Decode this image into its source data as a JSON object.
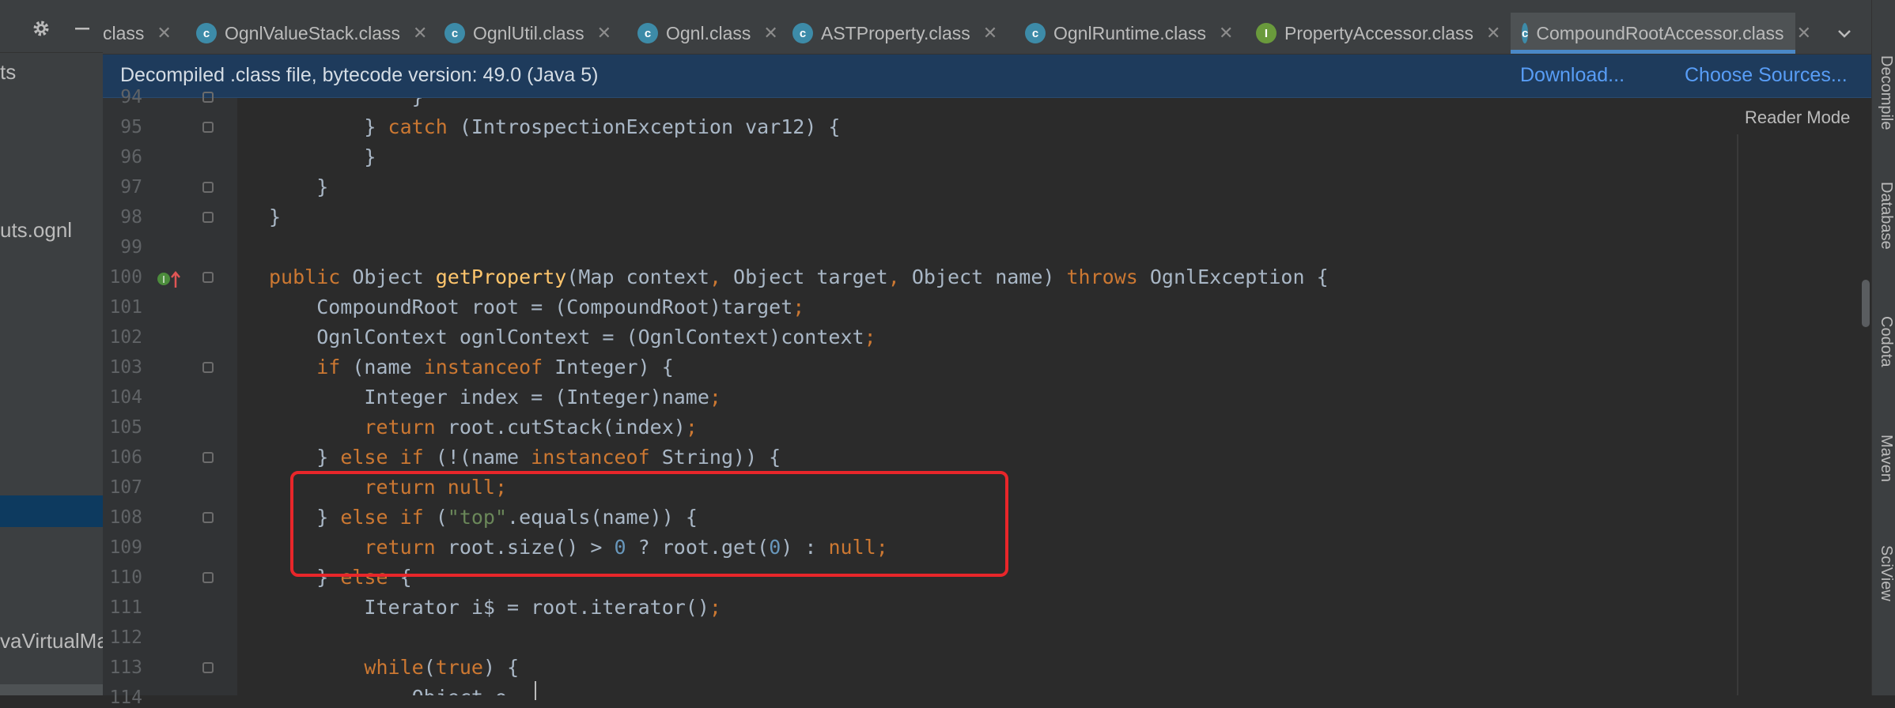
{
  "left_panel": {
    "items": [
      {
        "label": "ts"
      },
      {
        "label": "uts.ognl"
      },
      {
        "label": "vaVirtualMa"
      }
    ]
  },
  "tabs": [
    {
      "label": "class",
      "icon": "class-icon",
      "active": false
    },
    {
      "label": "OgnlValueStack.class",
      "icon": "class-icon",
      "active": false
    },
    {
      "label": "OgnlUtil.class",
      "icon": "class-icon",
      "active": false
    },
    {
      "label": "Ognl.class",
      "icon": "class-icon",
      "active": false
    },
    {
      "label": "ASTProperty.class",
      "icon": "class-icon",
      "active": false
    },
    {
      "label": "OgnlRuntime.class",
      "icon": "class-icon",
      "active": false
    },
    {
      "label": "PropertyAccessor.class",
      "icon": "interface-icon",
      "active": false
    },
    {
      "label": "CompoundRootAccessor.class",
      "icon": "class-icon",
      "active": true
    }
  ],
  "banner": {
    "text": "Decompiled .class file, bytecode version: 49.0 (Java 5)",
    "download_label": "Download...",
    "choose_sources_label": "Choose Sources..."
  },
  "reader_mode_label": "Reader Mode",
  "right_sidebar": {
    "items": [
      "Decompile",
      "Database",
      "Codota",
      "Maven",
      "SciView"
    ]
  },
  "code": {
    "lines": [
      {
        "n": "94",
        "text": "            }"
      },
      {
        "n": "95",
        "text": "        } catch (IntrospectionException var12) {"
      },
      {
        "n": "96",
        "text": "        }"
      },
      {
        "n": "97",
        "text": "    }"
      },
      {
        "n": "98",
        "text": "}"
      },
      {
        "n": "99",
        "text": ""
      },
      {
        "n": "100",
        "text": "public Object getProperty(Map context, Object target, Object name) throws OgnlException {"
      },
      {
        "n": "101",
        "text": "    CompoundRoot root = (CompoundRoot)target;"
      },
      {
        "n": "102",
        "text": "    OgnlContext ognlContext = (OgnlContext)context;"
      },
      {
        "n": "103",
        "text": "    if (name instanceof Integer) {"
      },
      {
        "n": "104",
        "text": "        Integer index = (Integer)name;"
      },
      {
        "n": "105",
        "text": "        return root.cutStack(index);"
      },
      {
        "n": "106",
        "text": "    } else if (!(name instanceof String)) {"
      },
      {
        "n": "107",
        "text": "        return null;"
      },
      {
        "n": "108",
        "text": "    } else if (\"top\".equals(name)) {"
      },
      {
        "n": "109",
        "text": "        return root.size() > 0 ? root.get(0) : null;"
      },
      {
        "n": "110",
        "text": "    } else {"
      },
      {
        "n": "111",
        "text": "        Iterator i$ = root.iterator();"
      },
      {
        "n": "112",
        "text": ""
      },
      {
        "n": "113",
        "text": "        while(true) {"
      },
      {
        "n": "114",
        "text": "            Object o"
      }
    ]
  },
  "colors": {
    "keyword": "#cc7832",
    "method": "#ffc66d",
    "string": "#6a8759",
    "number": "#6897bb",
    "text": "#a9b7c6",
    "highlight": "#e8262a"
  }
}
